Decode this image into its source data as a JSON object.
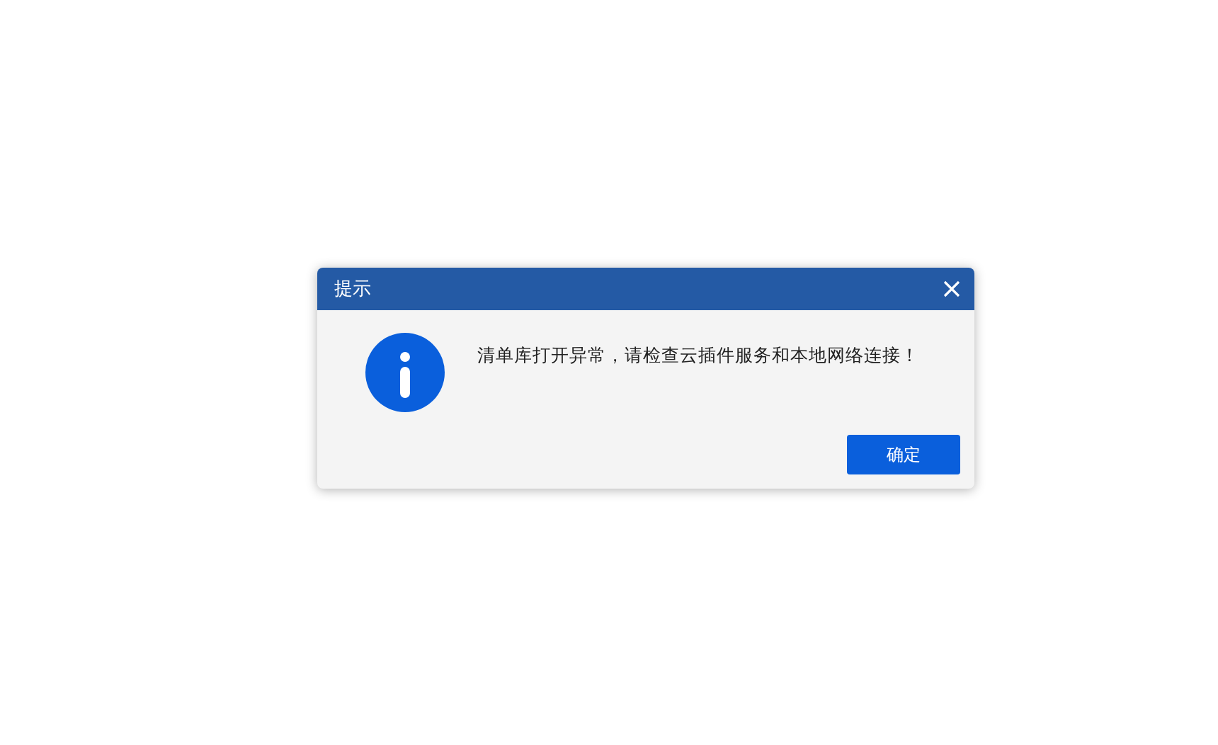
{
  "dialog": {
    "title": "提示",
    "message": "清单库打开异常，请检查云插件服务和本地网络连接！",
    "buttons": [
      "确定"
    ]
  }
}
